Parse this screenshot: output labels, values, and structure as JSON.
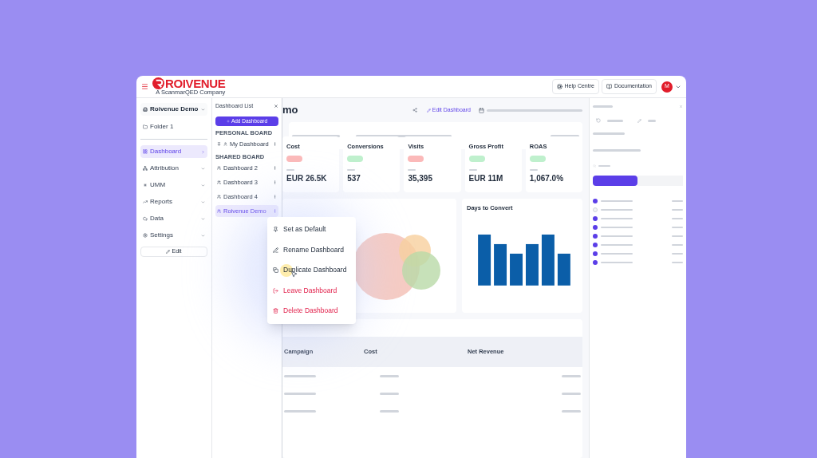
{
  "header": {
    "brand": "ROIVENUE",
    "tagline": "A ScanmarQED Company",
    "buttons": [
      {
        "label": "Help Centre",
        "kind": "help"
      },
      {
        "label": "Documentation",
        "kind": "docs"
      }
    ],
    "avatar": "M"
  },
  "sidebar": {
    "workspace": "Roivenue Demo",
    "folder": "Folder 1",
    "items": [
      {
        "label": "Dashboard",
        "kind": "dashboard",
        "selected": true
      },
      {
        "label": "Attribution",
        "kind": "attribution",
        "selected": false
      },
      {
        "label": "UMM",
        "kind": "umm",
        "selected": false
      },
      {
        "label": "Reports",
        "kind": "reports",
        "selected": false
      },
      {
        "label": "Data",
        "kind": "data",
        "selected": false
      },
      {
        "label": "Settings",
        "kind": "settings",
        "selected": false
      }
    ],
    "edit": "Edit"
  },
  "dashboard_list": {
    "title": "Dashboard List",
    "add": "Add Dashboard",
    "sections": [
      {
        "heading": "PERSONAL BOARD",
        "items": [
          {
            "label": "My Dashboard",
            "pinned": true,
            "selected": false
          }
        ]
      },
      {
        "heading": "SHARED BOARD",
        "items": [
          {
            "label": "Dashboard 2",
            "pinned": false,
            "selected": false
          },
          {
            "label": "Dashboard 3",
            "pinned": false,
            "selected": false
          },
          {
            "label": "Dashboard 4",
            "pinned": false,
            "selected": false
          },
          {
            "label": "Roivenue Demo",
            "pinned": false,
            "selected": true
          }
        ]
      }
    ]
  },
  "context_menu": [
    {
      "label": "Set as Default",
      "kind": "pin",
      "danger": false,
      "selected": false
    },
    {
      "label": "Rename Dashboard",
      "kind": "rename",
      "danger": false,
      "selected": false
    },
    {
      "label": "Duplicate Dashboard",
      "kind": "duplicate",
      "danger": false,
      "selected": true
    },
    {
      "label": "Leave Dashboard",
      "kind": "leave",
      "danger": true,
      "selected": false
    },
    {
      "label": "Delete Dashboard",
      "kind": "delete",
      "danger": true,
      "selected": false
    }
  ],
  "main": {
    "title": "mo",
    "edit": "Edit Dashboard",
    "kpis": [
      {
        "label": "Cost",
        "positive": false,
        "value": "EUR 26.5K"
      },
      {
        "label": "Conversions",
        "positive": true,
        "value": "537"
      },
      {
        "label": "Visits",
        "positive": false,
        "value": "35,395"
      },
      {
        "label": "Gross Profit",
        "positive": true,
        "value": "EUR 11M"
      },
      {
        "label": "ROAS",
        "positive": true,
        "value": "1,067.0%"
      }
    ],
    "chart_title": "Days to Convert",
    "table_columns": [
      "Campaign",
      "Cost",
      "Net Revenue"
    ]
  },
  "filter_panel": {
    "items": [
      {
        "checked": true
      },
      {
        "checked": false
      },
      {
        "checked": true
      },
      {
        "checked": true
      },
      {
        "checked": true
      },
      {
        "checked": true
      },
      {
        "checked": true
      },
      {
        "checked": true
      }
    ]
  }
}
